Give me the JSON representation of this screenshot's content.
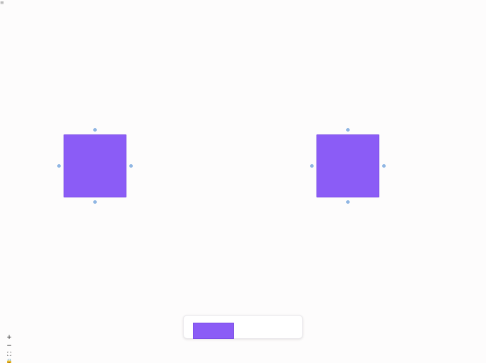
{
  "top_mark": "≡",
  "controls": {
    "zoom_in": "+",
    "zoom_out": "−",
    "fit_view": "⛶",
    "lock": "🔒"
  },
  "colors": {
    "node_fill": "#8b5cf6",
    "handle": "#8fb6e3",
    "background": "#fdfcfc"
  },
  "icons": [
    "zoom-in-icon",
    "zoom-out-icon",
    "fit-view-icon",
    "lock-icon",
    "menu-icon"
  ]
}
